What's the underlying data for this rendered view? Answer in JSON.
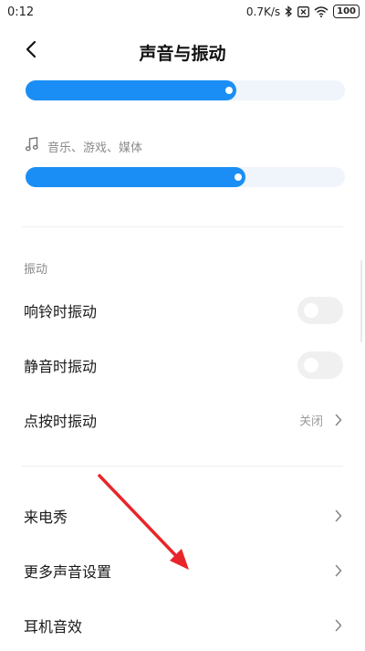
{
  "status_bar": {
    "time": "0:12",
    "network_speed": "0.7K/s",
    "battery": "100",
    "icons": [
      "bluetooth-icon",
      "sim-x-icon",
      "wifi-icon",
      "battery-icon"
    ]
  },
  "header": {
    "title": "声音与振动",
    "back_icon": "back-arrow-icon"
  },
  "volume": {
    "top_slider_level": 0.66,
    "media_label": "音乐、游戏、媒体",
    "media_icon": "music-note-icon",
    "media_slider_level": 0.69
  },
  "vibration": {
    "section_title": "振动",
    "ring_label": "响铃时振动",
    "ring_enabled": false,
    "silent_label": "静音时振动",
    "silent_enabled": false,
    "touch_label": "点按时振动",
    "touch_value": "关闭"
  },
  "more": {
    "ringtone_label": "来电秀",
    "more_sound_label": "更多声音设置",
    "headphone_label": "耳机音效"
  },
  "colors": {
    "accent": "#1a8ef5",
    "slider_track": "#f0f4fb",
    "annotation_arrow": "#e8262a"
  }
}
